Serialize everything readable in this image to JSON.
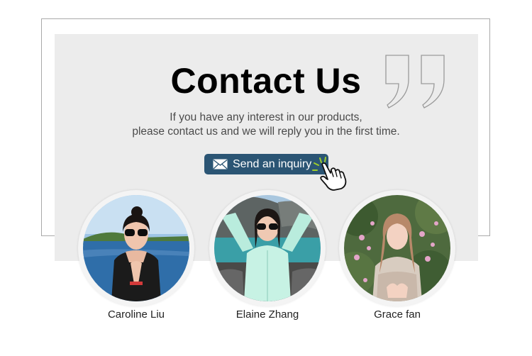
{
  "header": {
    "title": "Contact Us",
    "subtitle_line1": "If you have any interest in our products,",
    "subtitle_line2": "please contact us and we will reply you in the first time."
  },
  "inquiry": {
    "label": "Send an inquiry",
    "icon": "mail-icon",
    "cursor_icon": "hand-pointer-icon",
    "color": "#2b5574"
  },
  "decoration": {
    "icon": "quote-mark-icon"
  },
  "team": [
    {
      "name": "Caroline Liu"
    },
    {
      "name": "Elaine Zhang"
    },
    {
      "name": "Grace fan"
    }
  ]
}
